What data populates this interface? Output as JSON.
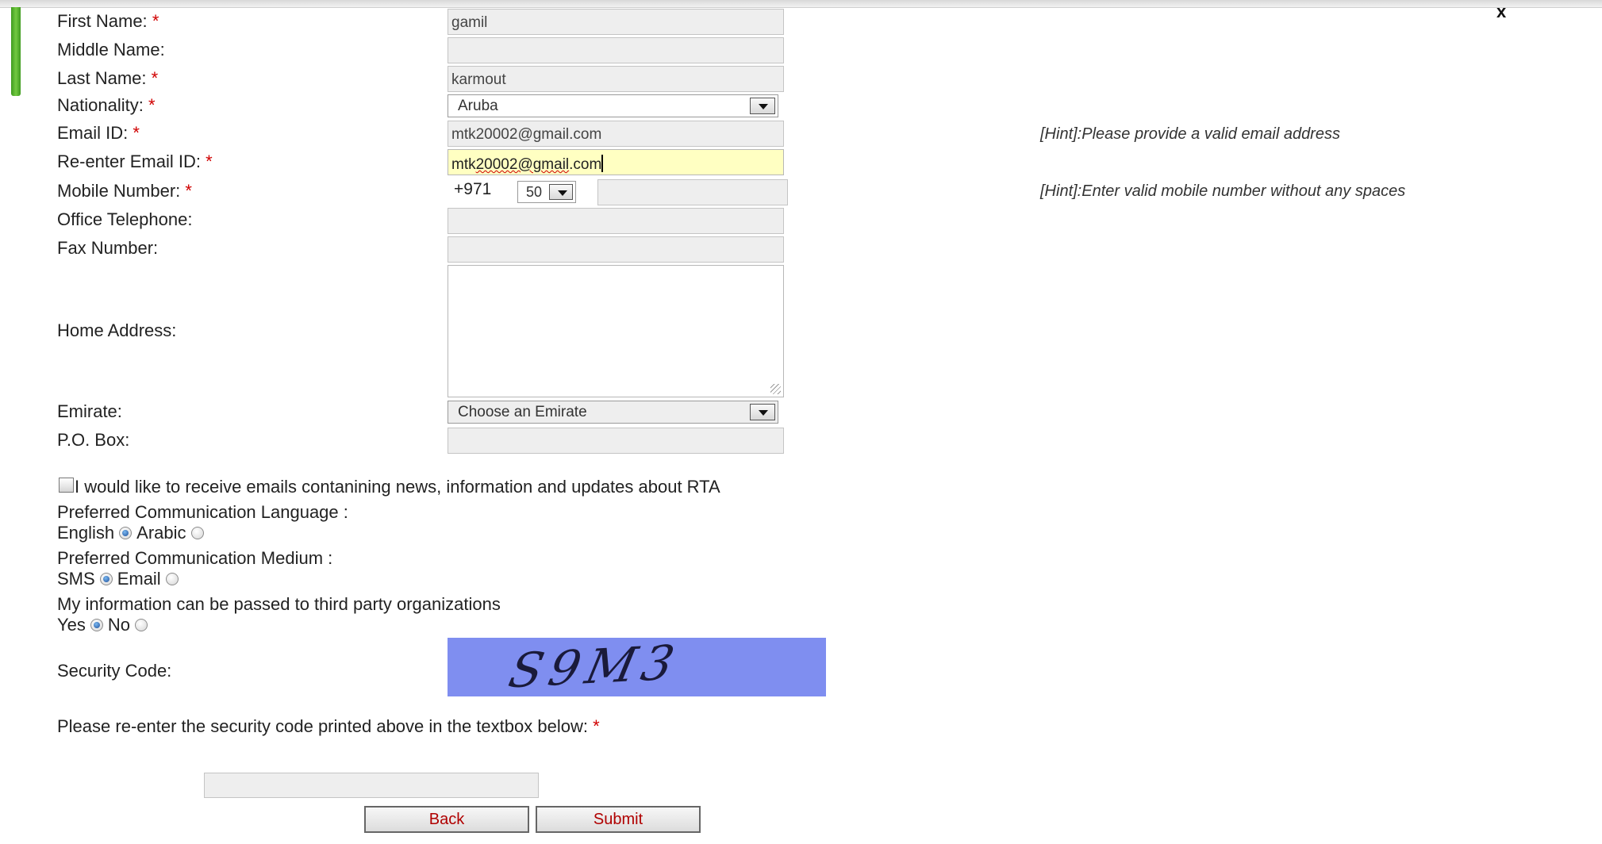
{
  "close_label": "x",
  "form": {
    "first_name": {
      "label": "First Name:",
      "required": "*",
      "value": "gamil"
    },
    "middle_name": {
      "label": "Middle Name:",
      "value": ""
    },
    "last_name": {
      "label": "Last Name:",
      "required": "*",
      "value": "karmout"
    },
    "nationality": {
      "label": "Nationality:",
      "required": "*",
      "value": "Aruba"
    },
    "email": {
      "label": "Email ID:",
      "required": "*",
      "value": "mtk20002@gmail.com",
      "hint": "[Hint]:Please provide a valid email address"
    },
    "reenter_email": {
      "label": "Re-enter Email ID:",
      "required": "*",
      "value_prefix": "mtk",
      "value_spell": "20002@gmail",
      "value_suffix": ".com"
    },
    "mobile": {
      "label": "Mobile Number:",
      "required": "*",
      "prefix": "+971",
      "code": "50",
      "value": "",
      "hint": "[Hint]:Enter valid mobile number without any spaces"
    },
    "office_phone": {
      "label": "Office Telephone:",
      "value": ""
    },
    "fax": {
      "label": "Fax Number:",
      "value": ""
    },
    "home_address": {
      "label": "Home Address:",
      "value": ""
    },
    "emirate": {
      "label": "Emirate:",
      "value": "Choose an Emirate"
    },
    "po_box": {
      "label": "P.O. Box:",
      "value": ""
    }
  },
  "newsletter": {
    "label": "I would like to receive emails contanining news, information and updates about RTA",
    "checked": false
  },
  "language": {
    "label": "Preferred Communication Language :",
    "options": [
      "English",
      "Arabic"
    ],
    "selected": "English"
  },
  "medium": {
    "label": "Preferred Communication Medium :",
    "options": [
      "SMS",
      "Email"
    ],
    "selected": "SMS"
  },
  "third_party": {
    "label": "My information can be passed to third party organizations",
    "options": [
      "Yes",
      "No"
    ],
    "selected": "Yes"
  },
  "security": {
    "label": "Security Code:",
    "captcha_text": "S9M3",
    "reenter_label": "Please re-enter the security code printed above in the textbox below:",
    "required": "*",
    "value": ""
  },
  "buttons": {
    "back": "Back",
    "submit": "Submit"
  },
  "colors": {
    "required": "#d00000",
    "captcha_bg": "#7f8ef0",
    "active_field": "#ffffc2",
    "button_text": "#b00000"
  }
}
